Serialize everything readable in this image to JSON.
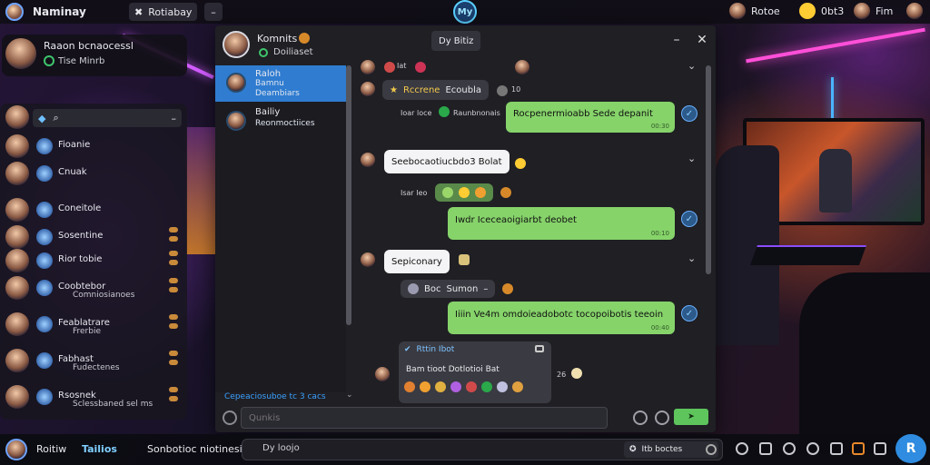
{
  "app": {
    "title": "Naminay",
    "center_logo": "My"
  },
  "topbar": {
    "tab_label": "Rotiabay",
    "tab_icon": "gamepad-icon",
    "minimize_icon": "minimize-icon",
    "users": [
      {
        "name": "Rotoe"
      },
      {
        "name": "0bt3"
      },
      {
        "name": "Fim"
      }
    ]
  },
  "notification": {
    "title": "Raaon bcnaocessl",
    "subtitle": "Tise Minrb"
  },
  "contacts": {
    "search_icon": "search-icon",
    "items": [
      {
        "name": "Fioanie",
        "sub": ""
      },
      {
        "name": "Cnuak",
        "sub": ""
      },
      {
        "name": "Coneitole",
        "sub": ""
      },
      {
        "name": "Sosentine",
        "sub": ""
      },
      {
        "name": "Rior tobie",
        "sub": ""
      },
      {
        "name": "Coobtebor",
        "sub": "Comniosianoes"
      },
      {
        "name": "Feablatrare",
        "sub": "Frerbie"
      },
      {
        "name": "Fabhast",
        "sub": "Fudectenes"
      },
      {
        "name": "Rsosnek",
        "sub": "Sclessbaned sel ms"
      }
    ]
  },
  "chat": {
    "header": {
      "title": "Komnits",
      "status": "Doiliaset",
      "pill": "Dy Bitiz"
    },
    "conversations": [
      {
        "l1": "Raloh",
        "l2": "Bamnu",
        "l3": "Deambiars"
      },
      {
        "l1": "Bailiy",
        "l2": "Reonmoctiices",
        "l3": ""
      }
    ],
    "conversations_footer": "Cepeaciosuboe tc 3 cacs",
    "messages": {
      "top_meta_1": "Iat",
      "grey_1": {
        "tag": "Rccrene",
        "text": "Ecoubla",
        "num": "10"
      },
      "meta_2": {
        "who": "Ioar loce",
        "what": "Raunbnonais"
      },
      "out_1": {
        "text": "Rocpenermioabb Sede depanit",
        "time": "00:30"
      },
      "in_1": {
        "text": "Seebocaotiucbdo3 Bolat"
      },
      "meta_3": {
        "who": "Isar Ieo"
      },
      "out_2": {
        "text": "Iwdr Iceceaoigiarbt deobet",
        "time": "00:10"
      },
      "in_2": {
        "text": "Sepiconary"
      },
      "grey_2": {
        "a": "Boc",
        "b": "Sumon"
      },
      "out_3": {
        "text": "Iiiin Ve4m omdoieadobotc tocopoibotis teeoin",
        "time": "00:40"
      },
      "sticker": {
        "top": "Rttin Ibot",
        "mid": "Bam tioot Dotlotioi Bat",
        "count": "26"
      }
    },
    "composer": {
      "placeholder": "Qunkis",
      "send_label": ""
    }
  },
  "bottombar": {
    "user": "Roitiw",
    "status": "Tailios",
    "label": "Sonbotioc niotinesioet",
    "search_placeholder": "Dy loojo",
    "search_inner": "Itb boctes",
    "fab": "R"
  }
}
